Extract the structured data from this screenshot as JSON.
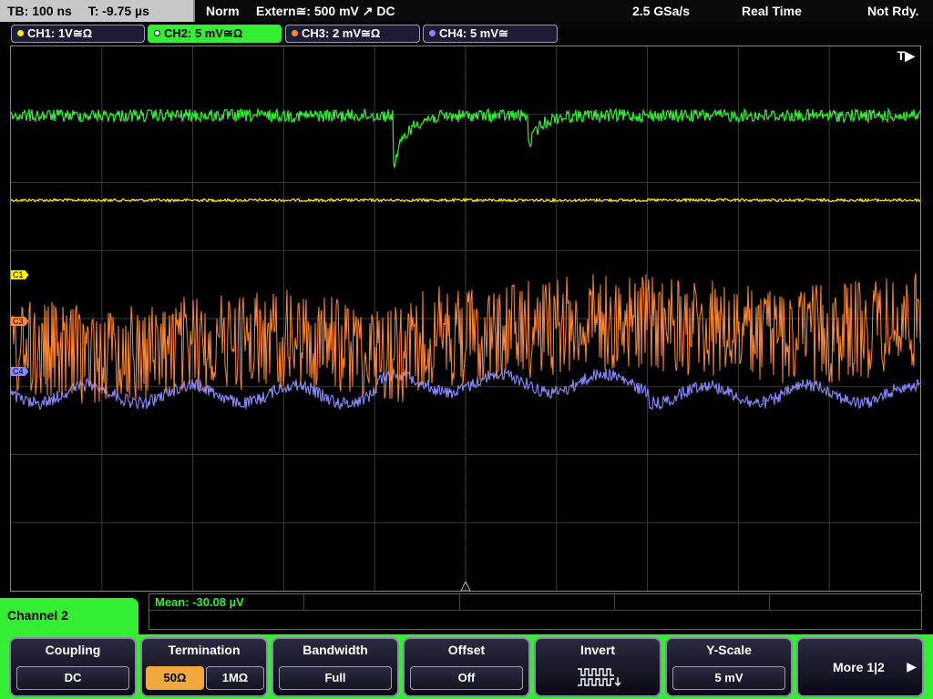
{
  "status": {
    "timebase": "TB: 100 ns",
    "trigger_time": "T: -9.75 µs",
    "mode": "Norm",
    "trigger_source": "Extern≅: 500 mV ↗ DC",
    "sample_rate": "2.5 GSa/s",
    "acq_mode": "Real Time",
    "ready_state": "Not Rdy."
  },
  "channels": [
    {
      "label": "CH1: 1V≅Ω",
      "color": "#ffee00"
    },
    {
      "label": "CH2: 5 mV≅Ω",
      "color": "#33ee33"
    },
    {
      "label": "CH3: 2 mV≅Ω",
      "color": "#ff8833"
    },
    {
      "label": "CH4: 5 mV≅",
      "color": "#8888ff"
    }
  ],
  "trace_markers": {
    "ch1": "C1",
    "ch3": "C3",
    "ch4": "C4",
    "trigger": "T"
  },
  "measurement": {
    "label": "Mean: -30.08 µV"
  },
  "panel": {
    "title": "Channel 2"
  },
  "softkeys": {
    "coupling": {
      "title": "Coupling",
      "value": "DC"
    },
    "termination": {
      "title": "Termination",
      "opt1": "50Ω",
      "opt2": "1MΩ"
    },
    "bandwidth": {
      "title": "Bandwidth",
      "value": "Full"
    },
    "offset": {
      "title": "Offset",
      "value": "Off"
    },
    "invert": {
      "title": "Invert"
    },
    "yscale": {
      "title": "Y-Scale",
      "value": "5 mV"
    },
    "more": {
      "label": "More 1|2"
    }
  }
}
